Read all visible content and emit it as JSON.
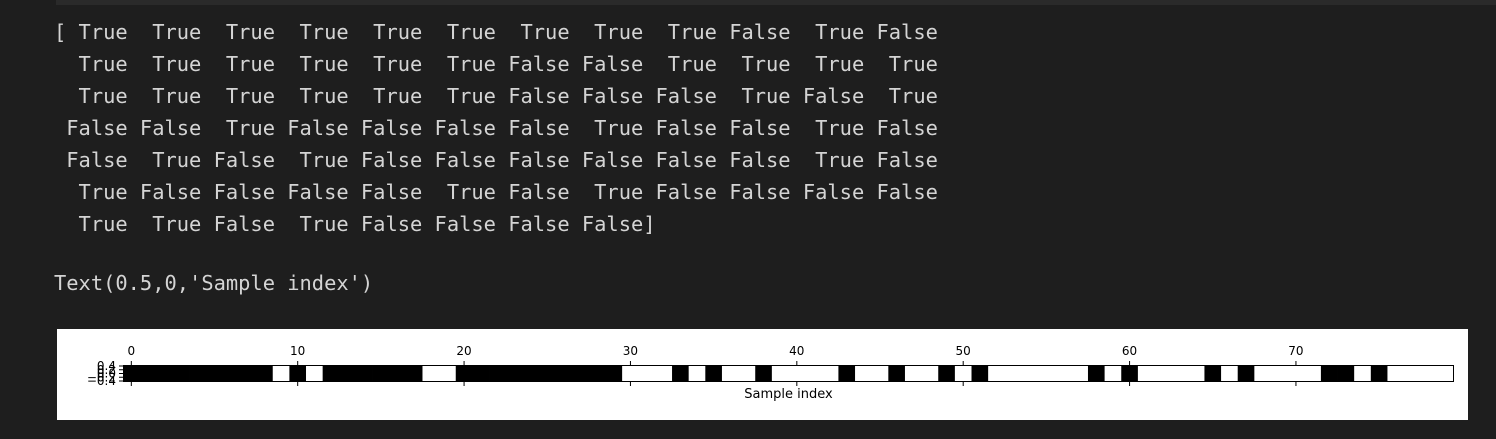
{
  "console": {
    "lines": [
      "[ True  True  True  True  True  True  True  True  True False  True False",
      "  True  True  True  True  True  True False False  True  True  True  True",
      "  True  True  True  True  True  True False False False  True False  True",
      " False False  True False False False False  True False False  True False",
      " False  True False  True False False False False False False  True False",
      "  True False False False False  True False  True False False False False",
      "  True  True False  True False False False False]"
    ],
    "text_repr": "Text(0.5,0,'Sample index')"
  },
  "chart_data": {
    "type": "heatmap",
    "title": "",
    "xlabel": "Sample index",
    "ylabel": "",
    "xlim": [
      -0.5,
      79.5
    ],
    "xticks": [
      0,
      10,
      20,
      30,
      40,
      50,
      60,
      70
    ],
    "yticks": [
      "−0.4",
      "−0.2",
      "0.0",
      "0.2",
      "0.4"
    ],
    "colormap": "gray_r",
    "values": [
      true,
      true,
      true,
      true,
      true,
      true,
      true,
      true,
      true,
      false,
      true,
      false,
      true,
      true,
      true,
      true,
      true,
      true,
      false,
      false,
      true,
      true,
      true,
      true,
      true,
      true,
      true,
      true,
      true,
      true,
      false,
      false,
      false,
      true,
      false,
      true,
      false,
      false,
      true,
      false,
      false,
      false,
      false,
      true,
      false,
      false,
      true,
      false,
      false,
      true,
      false,
      true,
      false,
      false,
      false,
      false,
      false,
      false,
      true,
      false,
      true,
      false,
      false,
      false,
      false,
      true,
      false,
      true,
      false,
      false,
      false,
      false,
      true,
      true,
      false,
      true,
      false,
      false,
      false,
      false
    ],
    "colors": {
      "true": "#000000",
      "false": "#ffffff"
    }
  }
}
